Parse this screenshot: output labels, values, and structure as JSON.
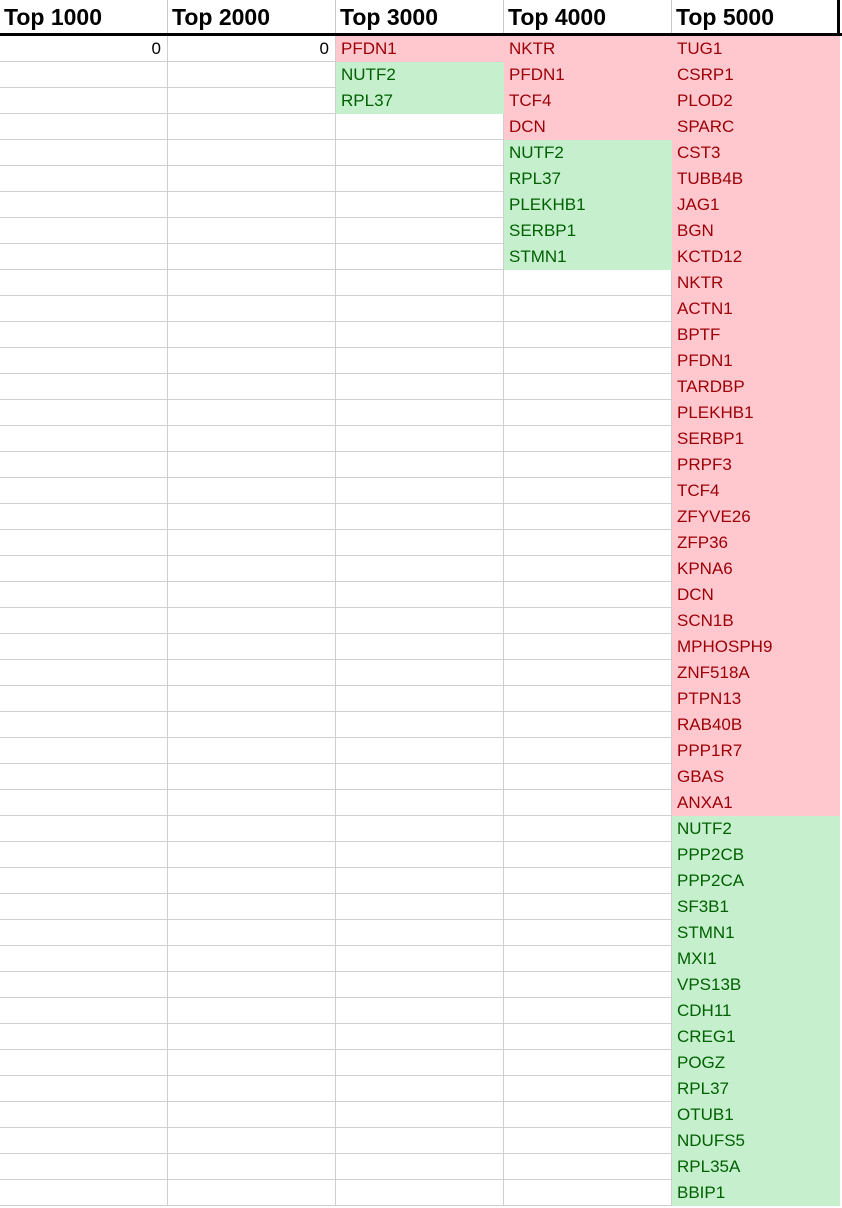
{
  "headers": [
    "Top 1000",
    "Top 2000",
    "Top 3000",
    "Top 4000",
    "Top 5000"
  ],
  "colors": {
    "red_fill": "#ffc7ce",
    "red_text": "#9c0006",
    "green_fill": "#c6efce",
    "green_text": "#006100"
  },
  "rows": [
    [
      {
        "v": "0",
        "t": "num"
      },
      {
        "v": "0",
        "t": "num"
      },
      {
        "v": "PFDN1",
        "t": "red"
      },
      {
        "v": "NKTR",
        "t": "red"
      },
      {
        "v": "TUG1",
        "t": "red"
      }
    ],
    [
      {
        "v": "",
        "t": ""
      },
      {
        "v": "",
        "t": ""
      },
      {
        "v": "NUTF2",
        "t": "green"
      },
      {
        "v": "PFDN1",
        "t": "red"
      },
      {
        "v": "CSRP1",
        "t": "red"
      }
    ],
    [
      {
        "v": "",
        "t": ""
      },
      {
        "v": "",
        "t": ""
      },
      {
        "v": "RPL37",
        "t": "green"
      },
      {
        "v": "TCF4",
        "t": "red"
      },
      {
        "v": "PLOD2",
        "t": "red"
      }
    ],
    [
      {
        "v": "",
        "t": ""
      },
      {
        "v": "",
        "t": ""
      },
      {
        "v": "",
        "t": ""
      },
      {
        "v": "DCN",
        "t": "red"
      },
      {
        "v": "SPARC",
        "t": "red"
      }
    ],
    [
      {
        "v": "",
        "t": ""
      },
      {
        "v": "",
        "t": ""
      },
      {
        "v": "",
        "t": ""
      },
      {
        "v": "NUTF2",
        "t": "green"
      },
      {
        "v": "CST3",
        "t": "red"
      }
    ],
    [
      {
        "v": "",
        "t": ""
      },
      {
        "v": "",
        "t": ""
      },
      {
        "v": "",
        "t": ""
      },
      {
        "v": "RPL37",
        "t": "green"
      },
      {
        "v": "TUBB4B",
        "t": "red"
      }
    ],
    [
      {
        "v": "",
        "t": ""
      },
      {
        "v": "",
        "t": ""
      },
      {
        "v": "",
        "t": ""
      },
      {
        "v": "PLEKHB1",
        "t": "green"
      },
      {
        "v": "JAG1",
        "t": "red"
      }
    ],
    [
      {
        "v": "",
        "t": ""
      },
      {
        "v": "",
        "t": ""
      },
      {
        "v": "",
        "t": ""
      },
      {
        "v": "SERBP1",
        "t": "green"
      },
      {
        "v": "BGN",
        "t": "red"
      }
    ],
    [
      {
        "v": "",
        "t": ""
      },
      {
        "v": "",
        "t": ""
      },
      {
        "v": "",
        "t": ""
      },
      {
        "v": "STMN1",
        "t": "green"
      },
      {
        "v": "KCTD12",
        "t": "red"
      }
    ],
    [
      {
        "v": "",
        "t": ""
      },
      {
        "v": "",
        "t": ""
      },
      {
        "v": "",
        "t": ""
      },
      {
        "v": "",
        "t": ""
      },
      {
        "v": "NKTR",
        "t": "red"
      }
    ],
    [
      {
        "v": "",
        "t": ""
      },
      {
        "v": "",
        "t": ""
      },
      {
        "v": "",
        "t": ""
      },
      {
        "v": "",
        "t": ""
      },
      {
        "v": "ACTN1",
        "t": "red"
      }
    ],
    [
      {
        "v": "",
        "t": ""
      },
      {
        "v": "",
        "t": ""
      },
      {
        "v": "",
        "t": ""
      },
      {
        "v": "",
        "t": ""
      },
      {
        "v": "BPTF",
        "t": "red"
      }
    ],
    [
      {
        "v": "",
        "t": ""
      },
      {
        "v": "",
        "t": ""
      },
      {
        "v": "",
        "t": ""
      },
      {
        "v": "",
        "t": ""
      },
      {
        "v": "PFDN1",
        "t": "red"
      }
    ],
    [
      {
        "v": "",
        "t": ""
      },
      {
        "v": "",
        "t": ""
      },
      {
        "v": "",
        "t": ""
      },
      {
        "v": "",
        "t": ""
      },
      {
        "v": "TARDBP",
        "t": "red"
      }
    ],
    [
      {
        "v": "",
        "t": ""
      },
      {
        "v": "",
        "t": ""
      },
      {
        "v": "",
        "t": ""
      },
      {
        "v": "",
        "t": ""
      },
      {
        "v": "PLEKHB1",
        "t": "red"
      }
    ],
    [
      {
        "v": "",
        "t": ""
      },
      {
        "v": "",
        "t": ""
      },
      {
        "v": "",
        "t": ""
      },
      {
        "v": "",
        "t": ""
      },
      {
        "v": "SERBP1",
        "t": "red"
      }
    ],
    [
      {
        "v": "",
        "t": ""
      },
      {
        "v": "",
        "t": ""
      },
      {
        "v": "",
        "t": ""
      },
      {
        "v": "",
        "t": ""
      },
      {
        "v": "PRPF3",
        "t": "red"
      }
    ],
    [
      {
        "v": "",
        "t": ""
      },
      {
        "v": "",
        "t": ""
      },
      {
        "v": "",
        "t": ""
      },
      {
        "v": "",
        "t": ""
      },
      {
        "v": "TCF4",
        "t": "red"
      }
    ],
    [
      {
        "v": "",
        "t": ""
      },
      {
        "v": "",
        "t": ""
      },
      {
        "v": "",
        "t": ""
      },
      {
        "v": "",
        "t": ""
      },
      {
        "v": "ZFYVE26",
        "t": "red"
      }
    ],
    [
      {
        "v": "",
        "t": ""
      },
      {
        "v": "",
        "t": ""
      },
      {
        "v": "",
        "t": ""
      },
      {
        "v": "",
        "t": ""
      },
      {
        "v": "ZFP36",
        "t": "red"
      }
    ],
    [
      {
        "v": "",
        "t": ""
      },
      {
        "v": "",
        "t": ""
      },
      {
        "v": "",
        "t": ""
      },
      {
        "v": "",
        "t": ""
      },
      {
        "v": "KPNA6",
        "t": "red"
      }
    ],
    [
      {
        "v": "",
        "t": ""
      },
      {
        "v": "",
        "t": ""
      },
      {
        "v": "",
        "t": ""
      },
      {
        "v": "",
        "t": ""
      },
      {
        "v": "DCN",
        "t": "red"
      }
    ],
    [
      {
        "v": "",
        "t": ""
      },
      {
        "v": "",
        "t": ""
      },
      {
        "v": "",
        "t": ""
      },
      {
        "v": "",
        "t": ""
      },
      {
        "v": "SCN1B",
        "t": "red"
      }
    ],
    [
      {
        "v": "",
        "t": ""
      },
      {
        "v": "",
        "t": ""
      },
      {
        "v": "",
        "t": ""
      },
      {
        "v": "",
        "t": ""
      },
      {
        "v": "MPHOSPH9",
        "t": "red"
      }
    ],
    [
      {
        "v": "",
        "t": ""
      },
      {
        "v": "",
        "t": ""
      },
      {
        "v": "",
        "t": ""
      },
      {
        "v": "",
        "t": ""
      },
      {
        "v": "ZNF518A",
        "t": "red"
      }
    ],
    [
      {
        "v": "",
        "t": ""
      },
      {
        "v": "",
        "t": ""
      },
      {
        "v": "",
        "t": ""
      },
      {
        "v": "",
        "t": ""
      },
      {
        "v": "PTPN13",
        "t": "red"
      }
    ],
    [
      {
        "v": "",
        "t": ""
      },
      {
        "v": "",
        "t": ""
      },
      {
        "v": "",
        "t": ""
      },
      {
        "v": "",
        "t": ""
      },
      {
        "v": "RAB40B",
        "t": "red"
      }
    ],
    [
      {
        "v": "",
        "t": ""
      },
      {
        "v": "",
        "t": ""
      },
      {
        "v": "",
        "t": ""
      },
      {
        "v": "",
        "t": ""
      },
      {
        "v": "PPP1R7",
        "t": "red"
      }
    ],
    [
      {
        "v": "",
        "t": ""
      },
      {
        "v": "",
        "t": ""
      },
      {
        "v": "",
        "t": ""
      },
      {
        "v": "",
        "t": ""
      },
      {
        "v": "GBAS",
        "t": "red"
      }
    ],
    [
      {
        "v": "",
        "t": ""
      },
      {
        "v": "",
        "t": ""
      },
      {
        "v": "",
        "t": ""
      },
      {
        "v": "",
        "t": ""
      },
      {
        "v": "ANXA1",
        "t": "red"
      }
    ],
    [
      {
        "v": "",
        "t": ""
      },
      {
        "v": "",
        "t": ""
      },
      {
        "v": "",
        "t": ""
      },
      {
        "v": "",
        "t": ""
      },
      {
        "v": "NUTF2",
        "t": "green"
      }
    ],
    [
      {
        "v": "",
        "t": ""
      },
      {
        "v": "",
        "t": ""
      },
      {
        "v": "",
        "t": ""
      },
      {
        "v": "",
        "t": ""
      },
      {
        "v": "PPP2CB",
        "t": "green"
      }
    ],
    [
      {
        "v": "",
        "t": ""
      },
      {
        "v": "",
        "t": ""
      },
      {
        "v": "",
        "t": ""
      },
      {
        "v": "",
        "t": ""
      },
      {
        "v": "PPP2CA",
        "t": "green"
      }
    ],
    [
      {
        "v": "",
        "t": ""
      },
      {
        "v": "",
        "t": ""
      },
      {
        "v": "",
        "t": ""
      },
      {
        "v": "",
        "t": ""
      },
      {
        "v": "SF3B1",
        "t": "green"
      }
    ],
    [
      {
        "v": "",
        "t": ""
      },
      {
        "v": "",
        "t": ""
      },
      {
        "v": "",
        "t": ""
      },
      {
        "v": "",
        "t": ""
      },
      {
        "v": "STMN1",
        "t": "green"
      }
    ],
    [
      {
        "v": "",
        "t": ""
      },
      {
        "v": "",
        "t": ""
      },
      {
        "v": "",
        "t": ""
      },
      {
        "v": "",
        "t": ""
      },
      {
        "v": "MXI1",
        "t": "green"
      }
    ],
    [
      {
        "v": "",
        "t": ""
      },
      {
        "v": "",
        "t": ""
      },
      {
        "v": "",
        "t": ""
      },
      {
        "v": "",
        "t": ""
      },
      {
        "v": "VPS13B",
        "t": "green"
      }
    ],
    [
      {
        "v": "",
        "t": ""
      },
      {
        "v": "",
        "t": ""
      },
      {
        "v": "",
        "t": ""
      },
      {
        "v": "",
        "t": ""
      },
      {
        "v": "CDH11",
        "t": "green"
      }
    ],
    [
      {
        "v": "",
        "t": ""
      },
      {
        "v": "",
        "t": ""
      },
      {
        "v": "",
        "t": ""
      },
      {
        "v": "",
        "t": ""
      },
      {
        "v": "CREG1",
        "t": "green"
      }
    ],
    [
      {
        "v": "",
        "t": ""
      },
      {
        "v": "",
        "t": ""
      },
      {
        "v": "",
        "t": ""
      },
      {
        "v": "",
        "t": ""
      },
      {
        "v": "POGZ",
        "t": "green"
      }
    ],
    [
      {
        "v": "",
        "t": ""
      },
      {
        "v": "",
        "t": ""
      },
      {
        "v": "",
        "t": ""
      },
      {
        "v": "",
        "t": ""
      },
      {
        "v": "RPL37",
        "t": "green"
      }
    ],
    [
      {
        "v": "",
        "t": ""
      },
      {
        "v": "",
        "t": ""
      },
      {
        "v": "",
        "t": ""
      },
      {
        "v": "",
        "t": ""
      },
      {
        "v": "OTUB1",
        "t": "green"
      }
    ],
    [
      {
        "v": "",
        "t": ""
      },
      {
        "v": "",
        "t": ""
      },
      {
        "v": "",
        "t": ""
      },
      {
        "v": "",
        "t": ""
      },
      {
        "v": "NDUFS5",
        "t": "green"
      }
    ],
    [
      {
        "v": "",
        "t": ""
      },
      {
        "v": "",
        "t": ""
      },
      {
        "v": "",
        "t": ""
      },
      {
        "v": "",
        "t": ""
      },
      {
        "v": "RPL35A",
        "t": "green"
      }
    ],
    [
      {
        "v": "",
        "t": ""
      },
      {
        "v": "",
        "t": ""
      },
      {
        "v": "",
        "t": ""
      },
      {
        "v": "",
        "t": ""
      },
      {
        "v": "BBIP1",
        "t": "green"
      }
    ]
  ]
}
